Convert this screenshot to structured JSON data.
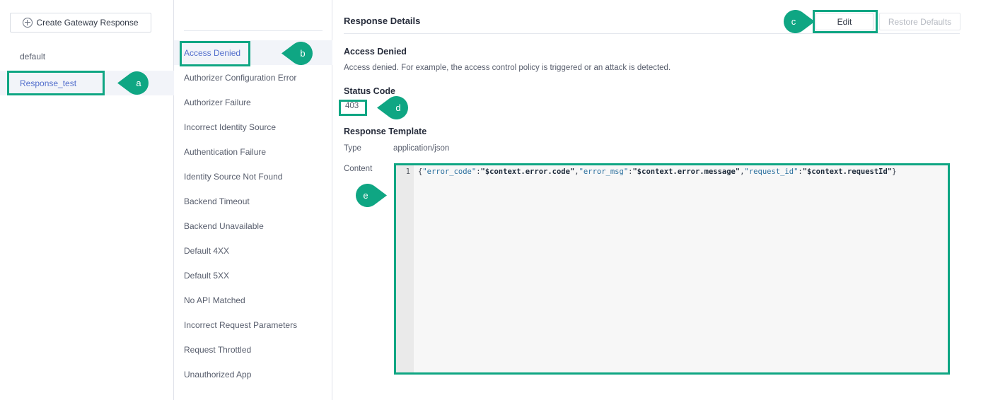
{
  "left_panel": {
    "create_button": {
      "label": "Create Gateway Response",
      "icon": "plus-circle-icon"
    },
    "items": [
      {
        "label": "default",
        "selected": false
      },
      {
        "label": "Response_test",
        "selected": true
      }
    ]
  },
  "mid_panel": {
    "items": [
      "Access Denied",
      "Authorizer Configuration Error",
      "Authorizer Failure",
      "Incorrect Identity Source",
      "Authentication Failure",
      "Identity Source Not Found",
      "Backend Timeout",
      "Backend Unavailable",
      "Default 4XX",
      "Default 5XX",
      "No API Matched",
      "Incorrect Request Parameters",
      "Request Throttled",
      "Unauthorized App"
    ],
    "active_item": "Access Denied"
  },
  "right_panel": {
    "title": "Response Details",
    "edit_button": "Edit",
    "restore_button": "Restore Defaults",
    "restore_button_disabled": true,
    "response_name": "Access Denied",
    "response_description": "Access denied. For example, the access control policy is triggered or an attack is detected.",
    "status_code_label": "Status Code",
    "status_code_value": "403",
    "response_template_label": "Response Template",
    "type_label": "Type",
    "type_value": "application/json",
    "content_label": "Content",
    "content_line_number": "1",
    "content_value": "{\"error_code\":\"$context.error.code\",\"error_msg\":\"$context.error.message\",\"request_id\":\"$context.requestId\"}"
  },
  "annotations": {
    "accent_color": "#0fa683",
    "markers": [
      {
        "id": "a",
        "label": "a",
        "points": "left",
        "target": "Response_test list item"
      },
      {
        "id": "b",
        "label": "b",
        "points": "left",
        "target": "Access Denied error type"
      },
      {
        "id": "c",
        "label": "c",
        "points": "right",
        "target": "Edit button"
      },
      {
        "id": "d",
        "label": "d",
        "points": "left",
        "target": "Status code value"
      },
      {
        "id": "e",
        "label": "e",
        "points": "right",
        "target": "Content editor"
      }
    ]
  }
}
